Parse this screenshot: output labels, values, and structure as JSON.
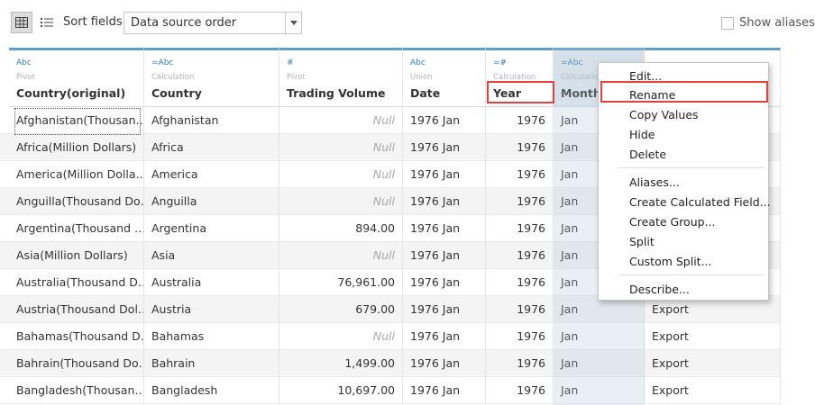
{
  "toolbar": {
    "grid_icon": "grid-view-icon",
    "list_icon": "list-view-icon",
    "sort_label": "Sort fields",
    "sort_value": "Data source order",
    "show_aliases": "Show aliases"
  },
  "columns": [
    {
      "type": "Abc",
      "origin": "Pivot",
      "name": "Country(original)"
    },
    {
      "type": "=Abc",
      "origin": "Calculation",
      "name": "Country"
    },
    {
      "type": "#",
      "origin": "Pivot",
      "name": "Trading Volume"
    },
    {
      "type": "Abc",
      "origin": "Union",
      "name": "Date"
    },
    {
      "type": "=#",
      "origin": "Calculation",
      "name": "Year"
    },
    {
      "type": "=Abc",
      "origin": "Calculation",
      "name": "Month"
    }
  ],
  "rows": [
    {
      "country_orig": "Afghanistan(Thousan…",
      "country": "Afghanistan",
      "volume": "Null",
      "date": "1976 Jan",
      "year": "1976",
      "month": "Jan",
      "extra": ""
    },
    {
      "country_orig": "Africa(Million Dollars)",
      "country": "Africa",
      "volume": "Null",
      "date": "1976 Jan",
      "year": "1976",
      "month": "Jan",
      "extra": ""
    },
    {
      "country_orig": "America(Million Dolla…",
      "country": "America",
      "volume": "Null",
      "date": "1976 Jan",
      "year": "1976",
      "month": "Jan",
      "extra": ""
    },
    {
      "country_orig": "Anguilla(Thousand Do…",
      "country": "Anguilla",
      "volume": "Null",
      "date": "1976 Jan",
      "year": "1976",
      "month": "Jan",
      "extra": ""
    },
    {
      "country_orig": "Argentina(Thousand …",
      "country": "Argentina",
      "volume": "894.00",
      "date": "1976 Jan",
      "year": "1976",
      "month": "Jan",
      "extra": ""
    },
    {
      "country_orig": "Asia(Million Dollars)",
      "country": "Asia",
      "volume": "Null",
      "date": "1976 Jan",
      "year": "1976",
      "month": "Jan",
      "extra": ""
    },
    {
      "country_orig": "Australia(Thousand D…",
      "country": "Australia",
      "volume": "76,961.00",
      "date": "1976 Jan",
      "year": "1976",
      "month": "Jan",
      "extra": ""
    },
    {
      "country_orig": "Austria(Thousand Dol…",
      "country": "Austria",
      "volume": "679.00",
      "date": "1976 Jan",
      "year": "1976",
      "month": "Jan",
      "extra": "Export"
    },
    {
      "country_orig": "Bahamas(Thousand D…",
      "country": "Bahamas",
      "volume": "Null",
      "date": "1976 Jan",
      "year": "1976",
      "month": "Jan",
      "extra": "Export"
    },
    {
      "country_orig": "Bahrain(Thousand Do…",
      "country": "Bahrain",
      "volume": "1,499.00",
      "date": "1976 Jan",
      "year": "1976",
      "month": "Jan",
      "extra": "Export"
    },
    {
      "country_orig": "Bangladesh(Thousan…",
      "country": "Bangladesh",
      "volume": "10,697.00",
      "date": "1976 Jan",
      "year": "1976",
      "month": "Jan",
      "extra": "Export"
    }
  ],
  "menu": {
    "edit": "Edit...",
    "rename": "Rename",
    "copy_values": "Copy Values",
    "hide": "Hide",
    "delete": "Delete",
    "aliases": "Aliases...",
    "create_calc": "Create Calculated Field...",
    "create_group": "Create Group...",
    "split": "Split",
    "custom_split": "Custom Split...",
    "describe": "Describe..."
  }
}
